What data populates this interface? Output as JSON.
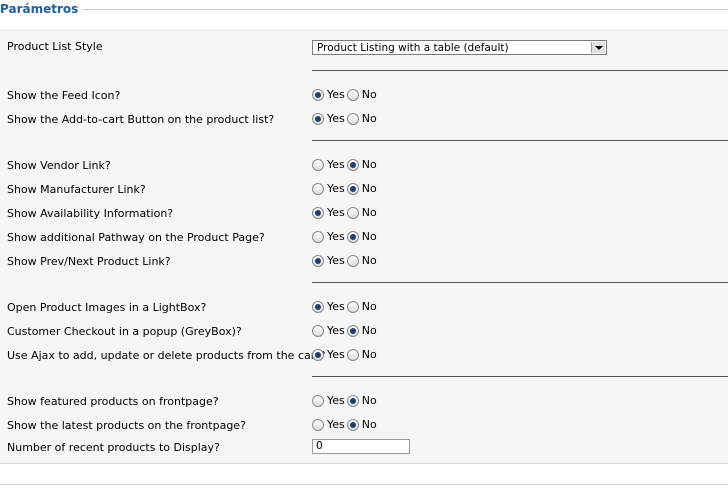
{
  "fieldset": {
    "legend": "Parámetros"
  },
  "product_list_style": {
    "label": "Product List Style",
    "selected": "Product Listing with a table (default)"
  },
  "options": [
    {
      "label": "Show the Feed Icon?",
      "value": "Yes"
    },
    {
      "label": "Show the Add-to-cart Button on the product list?",
      "value": "Yes"
    },
    {
      "label": "Show Vendor Link?",
      "value": "No"
    },
    {
      "label": "Show Manufacturer Link?",
      "value": "No"
    },
    {
      "label": "Show Availability Information?",
      "value": "Yes"
    },
    {
      "label": "Show additional Pathway on the Product Page?",
      "value": "No"
    },
    {
      "label": "Show Prev/Next Product Link?",
      "value": "Yes"
    },
    {
      "label": "Open Product Images in a LightBox?",
      "value": "Yes"
    },
    {
      "label": "Customer Checkout in a popup (GreyBox)?",
      "value": "No"
    },
    {
      "label": "Use Ajax to add, update or delete products from the cart?",
      "value": "Yes"
    },
    {
      "label": "Show featured products on frontpage?",
      "value": "No"
    },
    {
      "label": "Show the latest products on the frontpage?",
      "value": "No"
    }
  ],
  "radio_labels": {
    "yes": "Yes",
    "no": "No"
  },
  "recent_products": {
    "label": "Number of recent products to Display?",
    "value": "0"
  }
}
